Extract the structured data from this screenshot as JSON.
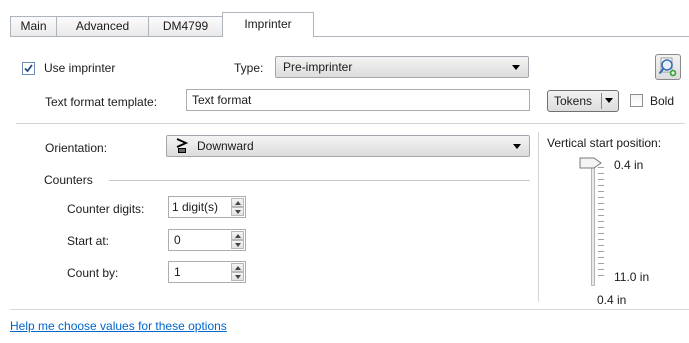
{
  "tabs": [
    {
      "label": "Main"
    },
    {
      "label": "Advanced"
    },
    {
      "label": "DM4799"
    },
    {
      "label": "Imprinter",
      "active": true
    }
  ],
  "use_imprinter": {
    "label": "Use imprinter",
    "checked": true
  },
  "type": {
    "label": "Type:",
    "value": "Pre-imprinter"
  },
  "text_format": {
    "label": "Text format template:",
    "value": "Text format"
  },
  "tokens_button": {
    "label": "Tokens"
  },
  "bold": {
    "label": "Bold",
    "checked": false
  },
  "orientation": {
    "label": "Orientation:",
    "value": "Downward",
    "icon": "text-downward-icon"
  },
  "counters": {
    "group_label": "Counters",
    "counter_digits": {
      "label": "Counter digits:",
      "value": "1 digit(s)"
    },
    "start_at": {
      "label": "Start at:",
      "value": "0"
    },
    "count_by": {
      "label": "Count by:",
      "value": "1"
    }
  },
  "vertical": {
    "label": "Vertical start position:",
    "top_label": "0.4 in",
    "bottom_label": "11.0 in",
    "current_value": "0.4 in",
    "position_fraction": 0
  },
  "help_link": "Help me choose values for these options",
  "colors": {
    "link": "#0066cc",
    "accent_border": "#6d8db4"
  },
  "icons": {
    "preview": "magnifier-preview-icon",
    "checkmark": "checkmark-icon"
  }
}
